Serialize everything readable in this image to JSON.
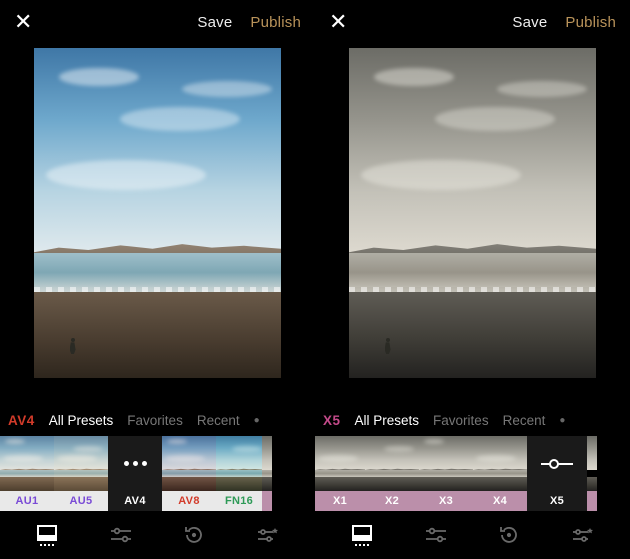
{
  "panes": [
    {
      "topbar": {
        "save": "Save",
        "publish": "Publish"
      },
      "active_preset": {
        "code": "AV4",
        "color": "#d23b2a"
      },
      "cats": {
        "all": "All Presets",
        "fav": "Favorites",
        "recent": "Recent"
      },
      "thumbs": [
        {
          "code": "AU1",
          "label_color": "#7a4bd6",
          "style": "light"
        },
        {
          "code": "AU5",
          "label_color": "#7a4bd6",
          "style": "light"
        },
        {
          "code": "AV4",
          "label_color": "#ffffff",
          "style": "dark",
          "current": true
        },
        {
          "code": "AV8",
          "label_color": "#d23b2a",
          "style": "light"
        },
        {
          "code": "FN16",
          "label_color": "#2e9a57",
          "style": "light"
        }
      ]
    },
    {
      "topbar": {
        "save": "Save",
        "publish": "Publish"
      },
      "active_preset": {
        "code": "X5",
        "color": "#c44a8a"
      },
      "cats": {
        "all": "All Presets",
        "fav": "Favorites",
        "recent": "Recent"
      },
      "thumbs": [
        {
          "code": "X1",
          "label_color": "#ffffff",
          "style": "pink"
        },
        {
          "code": "X2",
          "label_color": "#ffffff",
          "style": "pink"
        },
        {
          "code": "X3",
          "label_color": "#ffffff",
          "style": "pink"
        },
        {
          "code": "X4",
          "label_color": "#ffffff",
          "style": "pink"
        },
        {
          "code": "X5",
          "label_color": "#ffffff",
          "style": "dark",
          "current": true,
          "adjust_icon": true
        }
      ]
    }
  ],
  "tooltabs": [
    "presets",
    "sliders",
    "history",
    "recipes"
  ]
}
